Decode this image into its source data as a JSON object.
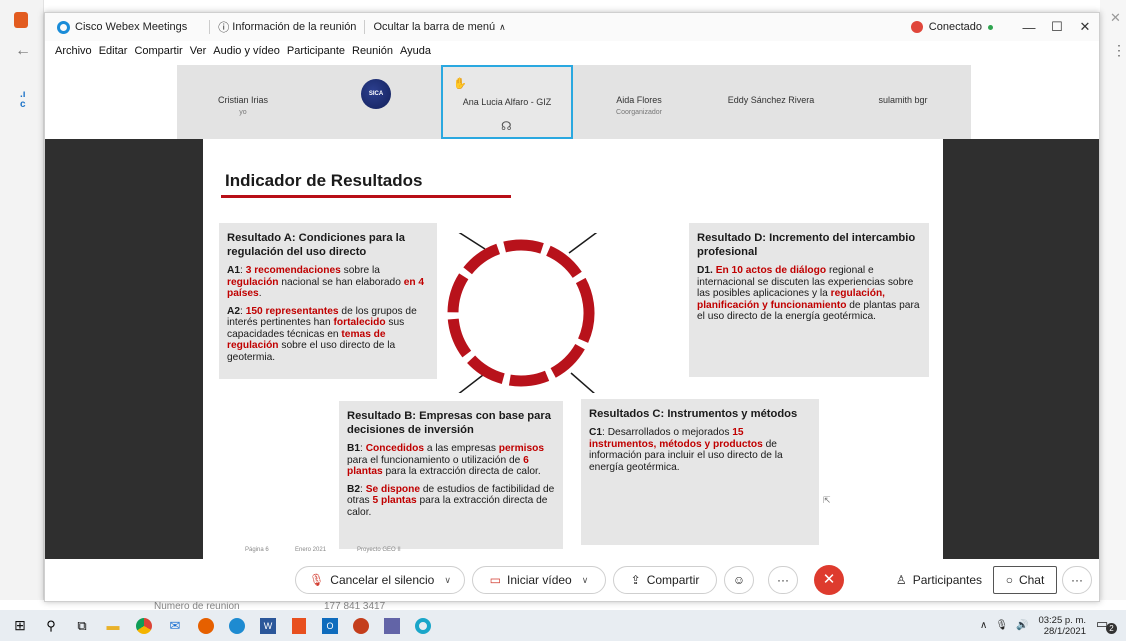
{
  "background": {
    "behind_text_1": "Numero de reunion",
    "behind_text_2": "177 841 3417"
  },
  "titlebar": {
    "app_name": "Cisco Webex Meetings",
    "meeting_info": "Información de la reunión",
    "hide_menu": "Ocultar la barra de menú",
    "status": "Conectado"
  },
  "menubar": [
    "Archivo",
    "Editar",
    "Compartir",
    "Ver",
    "Audio y vídeo",
    "Participante",
    "Reunión",
    "Ayuda"
  ],
  "participants": [
    {
      "name": "Cristian Irias",
      "sub": "yo"
    },
    {
      "name": "",
      "sub": "",
      "logo": "SICA"
    },
    {
      "name": "Ana Lucia Alfaro - GIZ",
      "sub": ""
    },
    {
      "name": "Aida Flores",
      "sub": "Coorganizador"
    },
    {
      "name": "Eddy Sánchez Rivera",
      "sub": ""
    },
    {
      "name": "sulamith bgr",
      "sub": ""
    }
  ],
  "slide": {
    "title": "Indicador de Resultados",
    "box_a": {
      "heading": "Resultado A: Condiciones para la regulación del uso directo",
      "a1_label": "A1",
      "a1_1": "3 recomendaciones",
      "a1_2": " sobre la ",
      "a1_3": "regulación",
      "a1_4": " nacional se han elaborado ",
      "a1_5": "en 4 países",
      "a1_6": ".",
      "a2_label": "A2",
      "a2_1": "150 representantes",
      "a2_2": " de los grupos de interés pertinentes han ",
      "a2_3": "fortalecido",
      "a2_4": " sus capacidades técnicas en ",
      "a2_5": "temas de regulación",
      "a2_6": " sobre el uso directo de la geotermia."
    },
    "box_d": {
      "heading": "Resultado D: Incremento del intercambio profesional",
      "d1_label": "D1.",
      "d1_1": "En 10 actos de diálogo",
      "d1_2": " regional e internacional se discuten las experiencias sobre las posibles aplicaciones y la ",
      "d1_3": "regulación, planificación y funcionamiento",
      "d1_4": " de plantas para el uso directo de la energía geotérmica."
    },
    "box_b": {
      "heading": "Resultado B: Empresas con base para decisiones de inversión",
      "b1_label": "B1",
      "b1_1": "Concedidos",
      "b1_2": " a las empresas ",
      "b1_3": "permisos",
      "b1_4": " para el funcionamiento o utilización de ",
      "b1_5": "6 plantas",
      "b1_6": " para la extracción directa de calor.",
      "b2_label": "B2",
      "b2_1": "Se dispone",
      "b2_2": " de estudios de factibilidad de otras ",
      "b2_3": "5 plantas",
      "b2_4": " para la extracción directa de calor."
    },
    "box_c": {
      "heading": "Resultados C: Instrumentos y métodos",
      "c1_label": "C1",
      "c1_1": ": Desarrollados o mejorados ",
      "c1_2": "15 instrumentos, métodos y productos",
      "c1_3": " de información para incluir el uso directo de la energía geotérmica."
    },
    "footer": [
      "Página 6",
      "Enero 2021",
      "Proyecto GEO II"
    ]
  },
  "controls": {
    "mute": "Cancelar el silencio",
    "video": "Iniciar vídeo",
    "share": "Compartir",
    "participants": "Participantes",
    "chat": "Chat"
  },
  "taskbar": {
    "time": "03:25 p. m.",
    "date": "28/1/2021",
    "notification_count": "2"
  },
  "colors": {
    "accent_red": "#c00000",
    "active_tile": "#2aa8e0",
    "leave_button": "#de3b2e"
  }
}
